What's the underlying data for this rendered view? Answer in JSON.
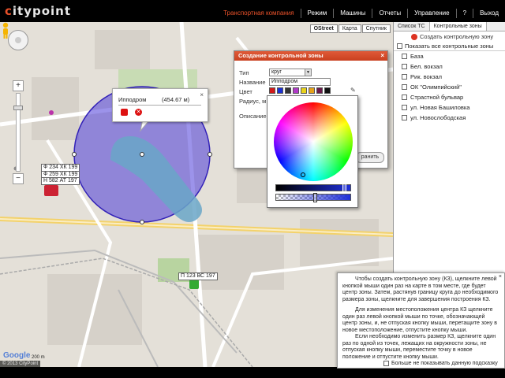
{
  "app": {
    "logo_text_1": "c",
    "logo_text_2": "itypoint"
  },
  "nav": {
    "items": [
      "Транспортная компания",
      "Режим",
      "Машины",
      "Отчеты",
      "Управление",
      "?",
      "Выход"
    ],
    "active_index": 0
  },
  "map": {
    "types": [
      "OStreet",
      "Карта",
      "Спутник"
    ],
    "active_type": "OStreet",
    "plates": [
      "Ф 234 ХК 199",
      "Ф 259 ХК 199",
      "Н 582 АТ 197",
      "П 123 ВС 197"
    ],
    "copyright": "© 2013 CityPoint",
    "google_logo": "Google",
    "scale": "200 m"
  },
  "popup": {
    "title": "Ипподром",
    "radius": "(454.67 м)",
    "close": "×"
  },
  "panel": {
    "tabs": [
      "Список ТС",
      "Контрольные зоны"
    ],
    "active_tab": 1,
    "create_label": "Создать контрольную зону",
    "show_all_label": "Показать все контрольные зоны",
    "zones": [
      "База",
      "Бел. вокзал",
      "Рик. вокзал",
      "ОК \"Олимпийский\"",
      "Страстной бульвар",
      "ул. Новая Башиловка",
      "ул. Новослободская"
    ]
  },
  "dialog": {
    "title": "Создание контрольной зоны",
    "close": "×",
    "type_label": "Тип",
    "type_value": "круг",
    "name_label": "Название",
    "name_value": "Ипподром",
    "color_label": "Цвет",
    "radius_label": "Радиус, м",
    "desc_label": "Описание",
    "save_label": "ранить",
    "swatch_colors": [
      "#d21a1a",
      "#1a2fd2",
      "#333333",
      "#b03ac8",
      "#e8d21a",
      "#e6a21a",
      "#6a1a4a",
      "#111111"
    ]
  },
  "picker": {
    "selected_color": "#1f2fd8"
  },
  "hint": {
    "close": "×",
    "p1": "Чтобы создать контрольную зону (КЗ), щелкните левой кнопкой мыши один раз на карте в том месте, где будет центр зоны. Затем, растянув границу круга до необходимого размера зоны, щелкните для завершения построения КЗ.",
    "p2": "Для изменения местоположения центра КЗ щелкните один раз левой кнопкой мыши по точке, обозначающей центр зоны, и, не отпуская кнопку мыши, перетащите зону в новое местоположение, отпустите кнопку мыши.",
    "p3": "Если необходимо изменить размер КЗ, щелкните один раз по одной из точек, лежащих на окружности зоны, не отпуская кнопку мыши, переместите точку в новое положение и отпустите кнопку мыши.",
    "dont_show_label": "Больше не показывать данную подсказку"
  }
}
